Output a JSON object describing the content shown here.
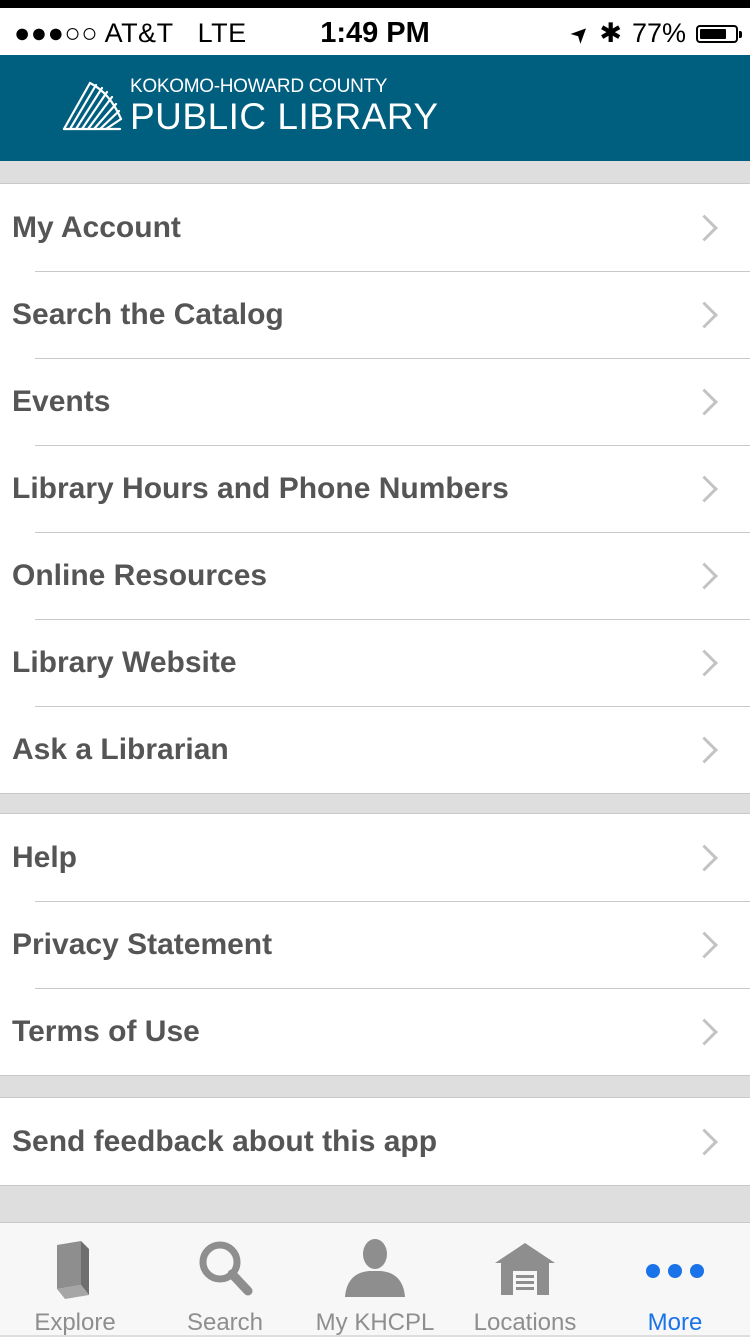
{
  "status_bar": {
    "signal": "●●●○○",
    "carrier": "AT&T",
    "network": "LTE",
    "time": "1:49 PM",
    "location_glyph": "➤",
    "bluetooth_glyph": "✱",
    "battery_percent_text": "77%",
    "battery_level": 0.77
  },
  "header": {
    "logo_top": "KOKOMO-HOWARD COUNTY",
    "logo_main": "PUBLIC LIBRARY",
    "background_color": "#005e7e"
  },
  "menu": {
    "section1": [
      {
        "label": "My Account"
      },
      {
        "label": "Search the Catalog"
      },
      {
        "label": "Events"
      },
      {
        "label": "Library Hours and Phone Numbers"
      },
      {
        "label": "Online Resources"
      },
      {
        "label": "Library Website"
      },
      {
        "label": "Ask a Librarian"
      }
    ],
    "section2": [
      {
        "label": "Help"
      },
      {
        "label": "Privacy Statement"
      },
      {
        "label": "Terms of Use"
      }
    ],
    "section3": [
      {
        "label": "Send feedback about this app"
      }
    ]
  },
  "tab_bar": {
    "tabs": [
      {
        "label": "Explore",
        "icon": "book-icon"
      },
      {
        "label": "Search",
        "icon": "search-icon"
      },
      {
        "label": "My KHCPL",
        "icon": "person-icon"
      },
      {
        "label": "Locations",
        "icon": "building-icon"
      },
      {
        "label": "More",
        "icon": "more-dots-icon"
      }
    ],
    "active_tab": "More",
    "active_color": "#1a73e8",
    "inactive_color": "#8e8e8e"
  }
}
